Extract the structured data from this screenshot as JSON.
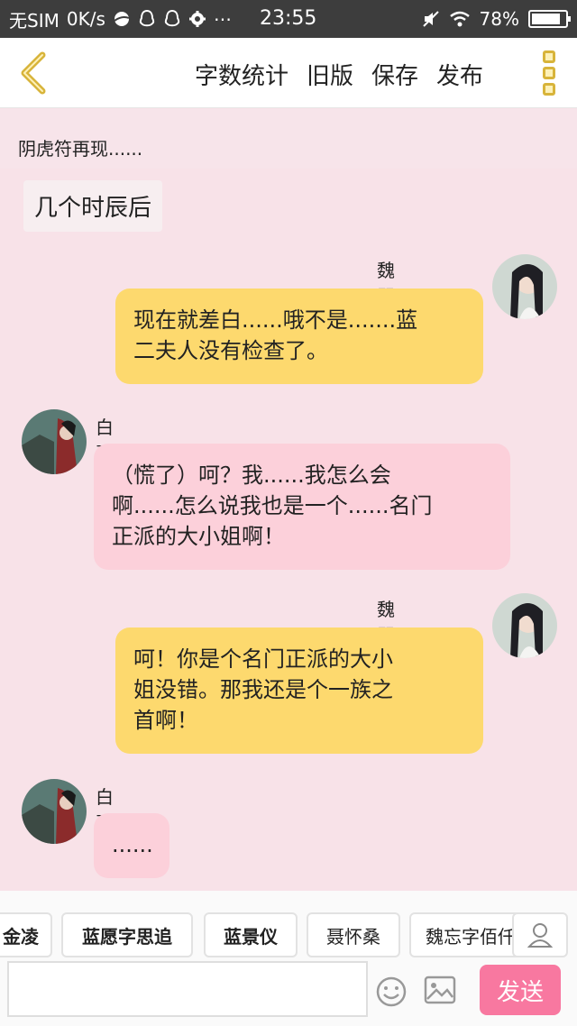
{
  "status_bar": {
    "carrier": "无SIM",
    "speed": "0K/s",
    "time": "23:55",
    "battery": "78%",
    "battery_level": 0.78
  },
  "toolbar": {
    "word_count": "字数统计",
    "old_version": "旧版",
    "save": "保存",
    "publish": "发布"
  },
  "narration": "阴虎符再现......",
  "time_tag": "几个时辰后",
  "messages": [
    {
      "name": "魏婴字无羡",
      "side": "right",
      "color": "yellow",
      "lines": [
        "现在就差白......哦不是.......蓝",
        "二夫人没有检查了。"
      ]
    },
    {
      "name": "白夏",
      "side": "left",
      "color": "pink",
      "lines": [
        "（慌了）呵？我......我怎么会",
        "啊......怎么说我也是一个......名门",
        "正派的大小姐啊！"
      ]
    },
    {
      "name": "魏婴字无羡",
      "side": "right",
      "color": "yellow",
      "lines": [
        "呵！你是个名门正派的大小",
        "姐没错。那我还是个一族之",
        "首啊！"
      ]
    },
    {
      "name": "白夏",
      "side": "left",
      "color": "pink",
      "lines": [
        "......"
      ]
    }
  ],
  "characters": [
    "金凌",
    "蓝愿字思追",
    "蓝景仪",
    "聂怀桑",
    "魏忘字佰仟"
  ],
  "input": {
    "placeholder": "",
    "send": "发送"
  },
  "colors": {
    "background": "#f8e2e8",
    "right_bubble": "#fdd96e",
    "left_bubble": "#fcd0da",
    "send_button": "#f878a0",
    "back_arrow": "#d8b43a"
  }
}
